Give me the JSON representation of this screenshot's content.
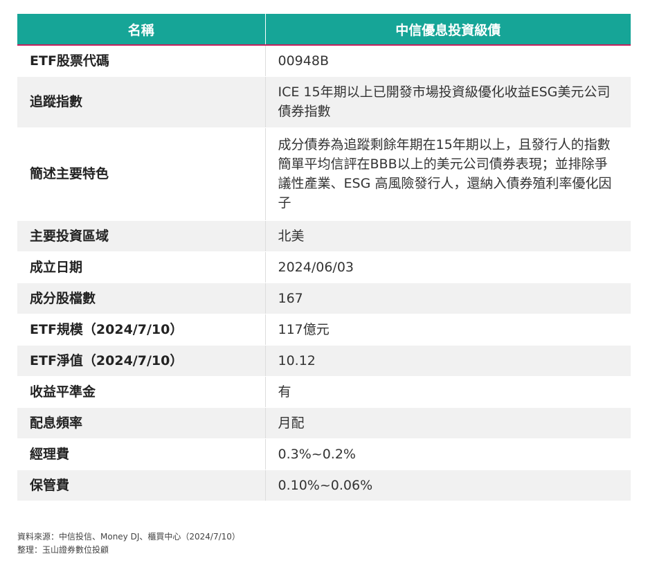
{
  "table": {
    "header": {
      "col1": "名稱",
      "col2": "中信優息投資級債"
    },
    "rows": [
      {
        "label": "ETF股票代碼",
        "value": "00948B"
      },
      {
        "label": "追蹤指數",
        "value": "ICE 15年期以上已開發市場投資級優化收益ESG美元公司債券指數"
      },
      {
        "label": "簡述主要特色",
        "value": "成分債券為追蹤剩餘年期在15年期以上，且發行人的指數簡單平均信評在BBB以上的美元公司債券表現；並排除爭議性產業、ESG 高風險發行人，還納入債券殖利率優化因子"
      },
      {
        "label": "主要投資區域",
        "value": "北美"
      },
      {
        "label": "成立日期",
        "value": "2024/06/03"
      },
      {
        "label": "成分股檔數",
        "value": "167"
      },
      {
        "label": "ETF規模（2024/7/10）",
        "value": "117億元"
      },
      {
        "label": "ETF淨值（2024/7/10）",
        "value": "10.12"
      },
      {
        "label": "收益平準金",
        "value": "有"
      },
      {
        "label": "配息頻率",
        "value": "月配"
      },
      {
        "label": "經理費",
        "value": "0.3%~0.2%"
      },
      {
        "label": "保管費",
        "value": "0.10%~0.06%"
      }
    ]
  },
  "footer": {
    "source": "資料來源：中信投信、Money DJ、櫃買中心（2024/7/10）",
    "compiled_by": "整理：玉山證券數位投顧"
  },
  "colors": {
    "header_bg": "#16a597",
    "header_line": "#c51f5d",
    "stripe": "#f1f1f1"
  }
}
